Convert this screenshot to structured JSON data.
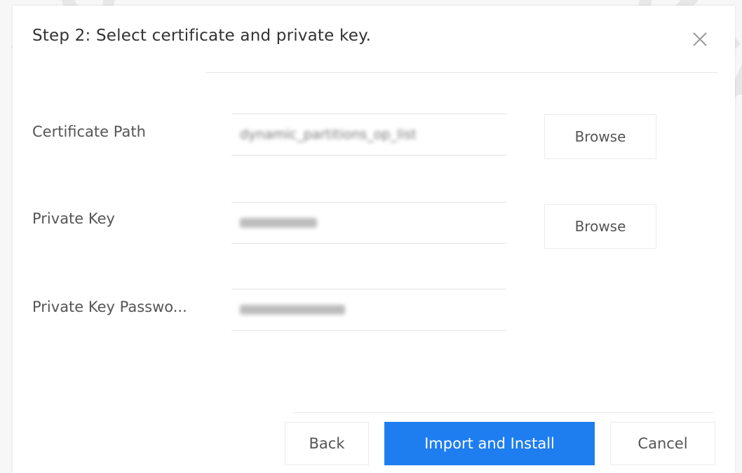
{
  "dialog": {
    "title": "Step 2: Select certificate and private key.",
    "close_icon": "close-icon"
  },
  "form": {
    "fields": [
      {
        "label": "Certificate Path",
        "value": "dynamic_partitions_op_list",
        "button": "Browse"
      },
      {
        "label": "Private Key",
        "value": "",
        "button": "Browse"
      },
      {
        "label": "Private Key Passwo...",
        "value": ""
      }
    ]
  },
  "footer": {
    "back_label": "Back",
    "import_label": "Import and Install",
    "cancel_label": "Cancel"
  },
  "watermark": {
    "text": "DOLESAN SECURITY"
  },
  "colors": {
    "accent": "#1e7ef0",
    "text": "#555555",
    "border": "#e4e4e4"
  }
}
